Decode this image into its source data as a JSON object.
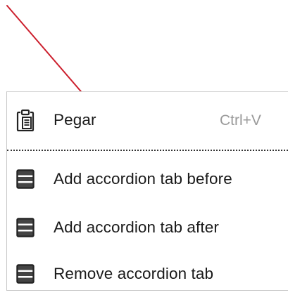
{
  "menu": {
    "paste": {
      "label": "Pegar",
      "shortcut": "Ctrl+V",
      "icon": "clipboard-icon"
    },
    "add_before": {
      "label": "Add accordion tab before",
      "icon": "accordion-icon"
    },
    "add_after": {
      "label": "Add accordion tab after",
      "icon": "accordion-icon"
    },
    "remove": {
      "label": "Remove accordion tab",
      "icon": "accordion-icon"
    }
  },
  "colors": {
    "annotation_arrow": "#cc1f2d",
    "label_text": "#1a1a1a",
    "shortcut_text": "#9a9a9a",
    "separator": "#333333"
  }
}
